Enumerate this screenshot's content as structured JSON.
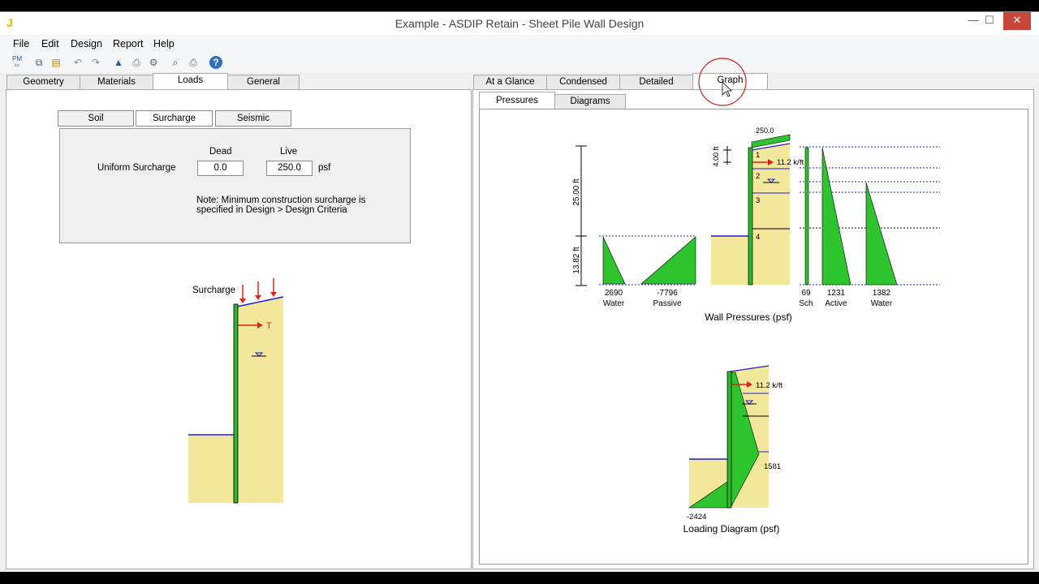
{
  "window": {
    "title": "Example - ASDIP Retain - Sheet Pile Wall Design",
    "app_icon": "J",
    "min": "—",
    "max": "☐",
    "close": "✕"
  },
  "menu": [
    "File",
    "Edit",
    "Design",
    "Report",
    "Help"
  ],
  "toolbar": {
    "icons": [
      "pm-back-icon",
      "copy-icon",
      "paste-icon",
      "undo-icon",
      "redo-icon",
      "design-icon",
      "print-setup-icon",
      "settings-icon",
      "preview-icon",
      "print-icon",
      "help-icon"
    ],
    "pm_label": "PM"
  },
  "left_tabs": [
    "Geometry",
    "Materials",
    "Loads",
    "General"
  ],
  "left_active": "Loads",
  "load_tabs": [
    "Soil",
    "Surcharge",
    "Seismic"
  ],
  "load_active": "Surcharge",
  "surcharge": {
    "dead_header": "Dead",
    "live_header": "Live",
    "row_label": "Uniform Surcharge",
    "dead_value": "0.0",
    "live_value": "250.0",
    "unit": "psf",
    "note_line1": "Note: Minimum construction surcharge is",
    "note_line2": "specified in Design > Design Criteria"
  },
  "sketch": {
    "surcharge_label": "Surcharge",
    "tie_label": "T"
  },
  "right_tabs": [
    "At a Glance",
    "Condensed",
    "Detailed",
    "Graph"
  ],
  "right_active": "Graph",
  "graph_tabs": [
    "Pressures",
    "Diagrams"
  ],
  "graph_active": "Pressures",
  "pressures": {
    "dim_upper": "25.00 ft",
    "dim_lower": "13.82 ft",
    "dim_tie": "4.00 ft",
    "surcharge_value": "250.0",
    "tie_force": "11.2 k/ft",
    "layers": [
      "1",
      "2",
      "3",
      "4"
    ],
    "labels": [
      {
        "value": "2690",
        "name": "Water"
      },
      {
        "value": "-7796",
        "name": "Passive"
      },
      {
        "value": "69",
        "name": "Sch"
      },
      {
        "value": "1231",
        "name": "Active"
      },
      {
        "value": "1382",
        "name": "Water"
      }
    ],
    "caption": "Wall Pressures (psf)"
  },
  "loading": {
    "tie_force": "11.2 k/ft",
    "max_pos": "1581",
    "max_neg": "-2424",
    "caption": "Loading Diagram (psf)"
  },
  "colors": {
    "soil": "#f2e79a",
    "wall": "#2db52d",
    "load": "#2ec42e",
    "line_blue": "#1f1fd0",
    "arrow": "#e0201a"
  }
}
